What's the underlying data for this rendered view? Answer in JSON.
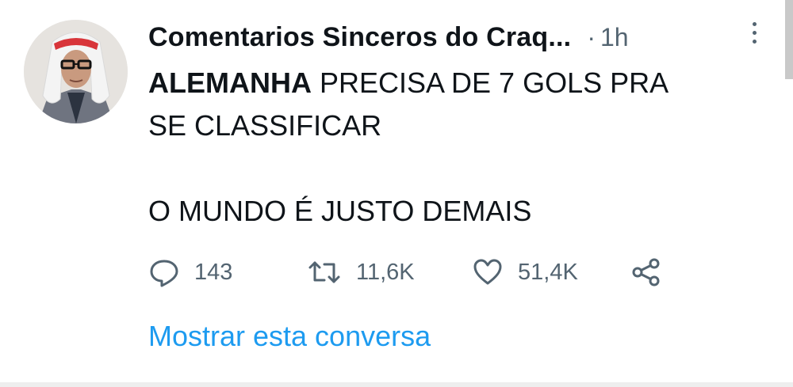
{
  "tweet": {
    "author_name": "Comentarios Sinceros do Craq...",
    "separator": "·",
    "time": "1h",
    "text_bold": "ALEMANHA",
    "text_line1_rest": " PRECISA DE 7 GOLS PRA",
    "text_line2": "SE CLASSIFICAR",
    "text_line3": "O MUNDO É JUSTO DEMAIS",
    "replies": "143",
    "retweets": "11,6K",
    "likes": "51,4K",
    "show_thread": "Mostrar esta conversa"
  },
  "icons": {
    "more": "vertical-dots-icon",
    "reply": "speech-bubble-icon",
    "retweet": "retweet-icon",
    "like": "heart-icon",
    "share": "share-icon"
  },
  "colors": {
    "text": "#0f1419",
    "secondary": "#536471",
    "link": "#1d9bf0"
  }
}
